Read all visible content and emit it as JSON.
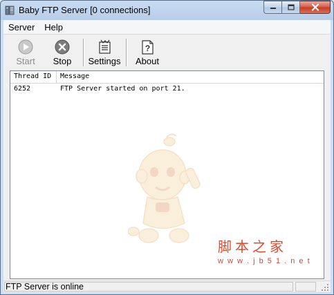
{
  "window": {
    "title": "Baby FTP Server [0 connections]"
  },
  "menu": {
    "items": [
      "Server",
      "Help"
    ]
  },
  "toolbar": {
    "start_label": "Start",
    "stop_label": "Stop",
    "settings_label": "Settings",
    "about_label": "About"
  },
  "log": {
    "columns": [
      "Thread ID",
      "Message"
    ],
    "rows": [
      {
        "thread_id": "6252",
        "message": "FTP Server started on port 21."
      }
    ]
  },
  "watermark": {
    "chinese": "脚本之家",
    "url": "w w w . j b 5 1 . n e t"
  },
  "status": {
    "text": "FTP Server is online"
  },
  "colors": {
    "titlebar": "#b7cde8",
    "close_button": "#c13d27",
    "watermark_text": "#e04a2a"
  }
}
